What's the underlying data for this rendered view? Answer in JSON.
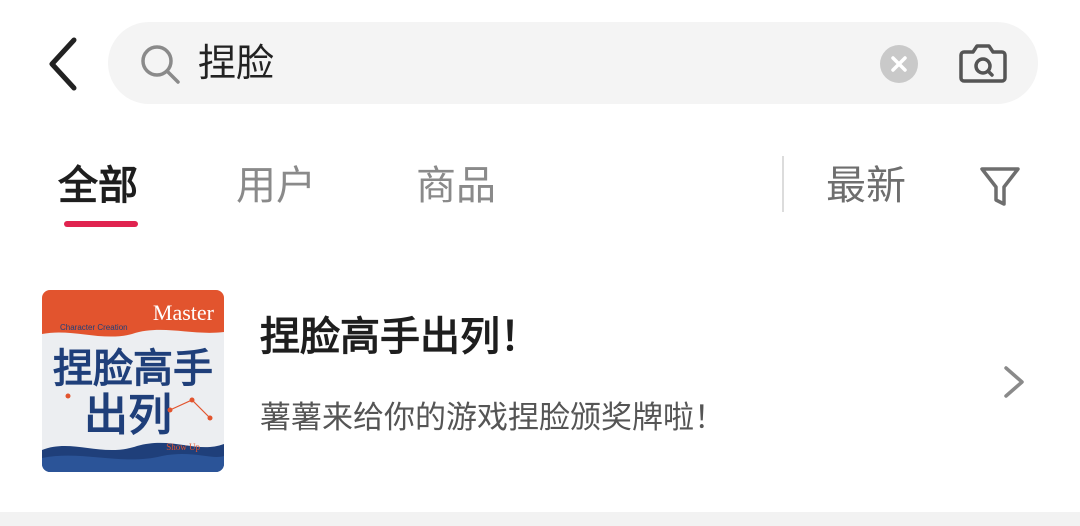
{
  "search": {
    "query": "捏脸",
    "icons": [
      "back-arrow-icon",
      "search-icon",
      "clear-icon",
      "camera-icon"
    ]
  },
  "tabs": [
    {
      "label": "全部",
      "active": true
    },
    {
      "label": "用户",
      "active": false
    },
    {
      "label": "商品",
      "active": false
    }
  ],
  "sort": {
    "label": "最新"
  },
  "filter": {
    "icon": "filter-icon"
  },
  "results": [
    {
      "title": "捏脸高手出列！",
      "description": "薯薯来给你的游戏捏脸颁奖牌啦！",
      "thumbnail": {
        "top_label": "Master",
        "small_label": "Character Creation",
        "main_text_line1": "捏脸高手",
        "main_text_line2": "出列",
        "bottom_label": "Show Up"
      }
    }
  ],
  "colors": {
    "accent": "#e0234f",
    "thumbnail_orange": "#e2542e",
    "thumbnail_navy": "#1f3f7a"
  }
}
